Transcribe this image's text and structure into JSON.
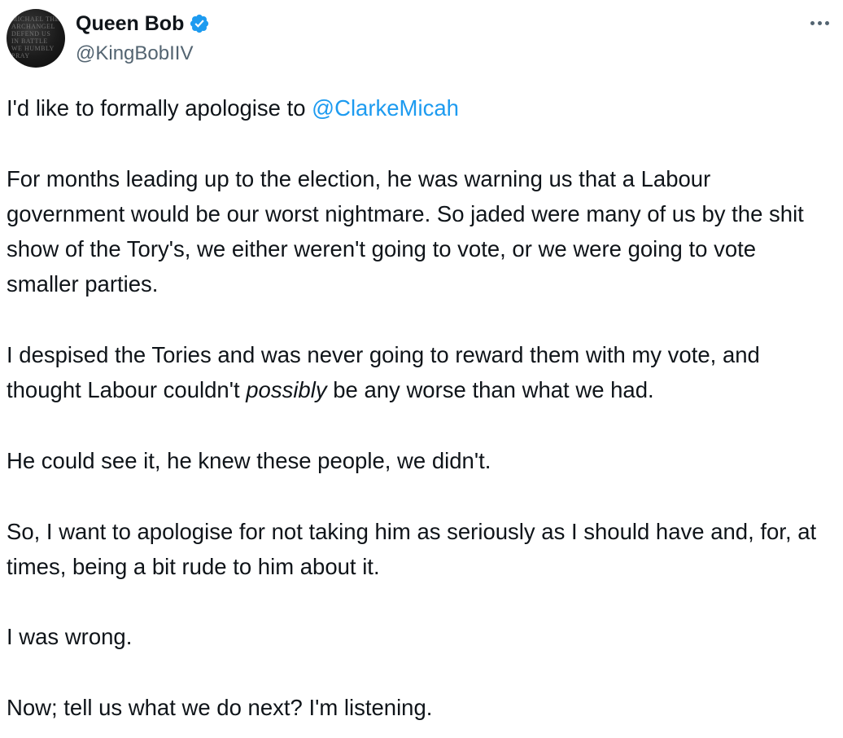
{
  "author": {
    "display_name": "Queen Bob",
    "handle": "@KingBobIIV",
    "verified_icon": "verified-badge-icon",
    "avatar_text": "MICHAEL THE ARCHANGEL DEFEND US IN BATTLE WE HUMBLY PRAY"
  },
  "menu": {
    "icon": "more-horizontal-icon"
  },
  "tweet": {
    "p1_prefix": "I'd like to formally apologise to ",
    "p1_mention": "@ClarkeMicah",
    "p2": "For months leading up to the election, he was warning us that a Labour government would be our worst nightmare. So jaded were many of us by the shit show of the Tory's, we either weren't going to vote, or we were going to vote smaller parties.",
    "p3_a": "I despised the Tories and was never going to reward them with my vote, and thought Labour couldn't ",
    "p3_em": "possibly",
    "p3_b": " be any worse than what we had.",
    "p4": "He could see it, he knew these people, we didn't.",
    "p5": "So, I want to apologise for not taking him as seriously as I should have and, for, at times, being a bit rude to him about it.",
    "p6": "I was wrong.",
    "p7": "Now; tell us what we do next? I'm listening."
  },
  "colors": {
    "accent": "#1d9bf0",
    "text": "#0f1419",
    "secondary": "#536471"
  }
}
